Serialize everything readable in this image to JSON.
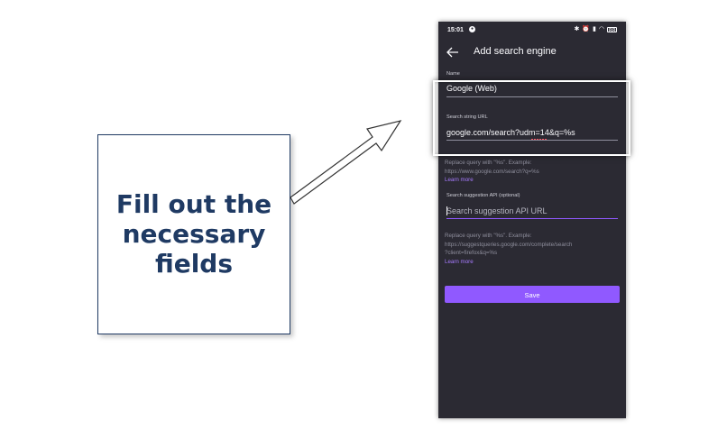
{
  "callout": {
    "text": "Fill out the\nnecessary\nfields"
  },
  "status_bar": {
    "time": "15:01",
    "battery": "88",
    "icons": [
      "bluetooth-icon",
      "alarm-icon",
      "signal-icon",
      "wifi-icon",
      "battery-icon"
    ]
  },
  "app_bar": {
    "title": "Add search engine",
    "back_icon": "back-arrow-icon"
  },
  "form": {
    "name": {
      "label": "Name",
      "value": "Google (Web)"
    },
    "search_url": {
      "label": "Search string URL",
      "value": "google.com/search?udm=14&q=%s",
      "helper": "Replace query with \"%s\". Example:\nhttps://www.google.com/search?q=%s",
      "learn_more": "Learn more"
    },
    "suggestion_api": {
      "label": "Search suggestion API (optional)",
      "placeholder": "Search suggestion API URL",
      "helper": "Replace query with \"%s\". Example:\nhttps://suggestqueries.google.com/complete/search\n?client=firefox&q=%s",
      "learn_more": "Learn more"
    },
    "save_label": "Save"
  },
  "colors": {
    "accent": "#9059ff",
    "background": "#2b2a33",
    "callout_text": "#1f3a63",
    "link": "#a77bff"
  }
}
